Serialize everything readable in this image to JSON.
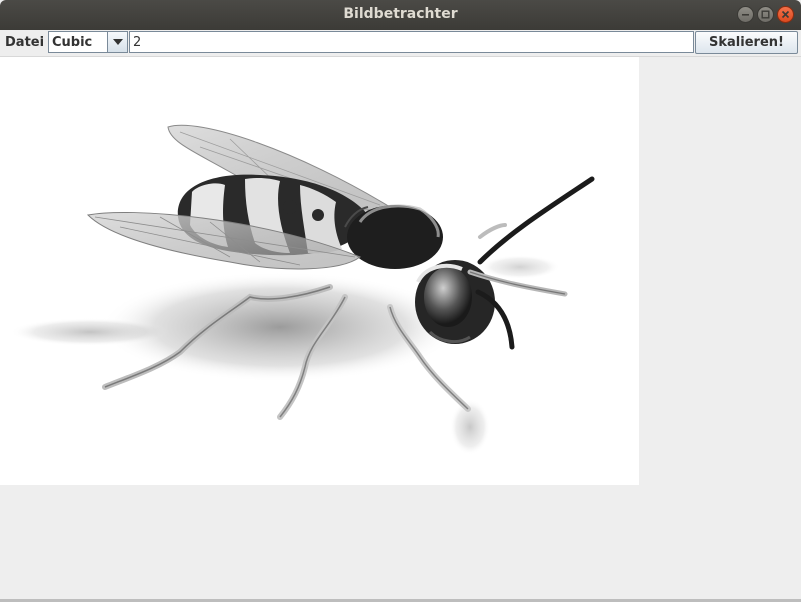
{
  "window": {
    "title": "Bildbetrachter",
    "controls": [
      "minimize-icon",
      "maximize-icon",
      "close-icon"
    ]
  },
  "menubar": {
    "datei_label": "Datei"
  },
  "toolbar": {
    "interpolation_selected": "Cubic",
    "scale_value": "2",
    "scale_button_label": "Skalieren!"
  },
  "image": {
    "subject": "wasp-photo-grayscale"
  },
  "colors": {
    "titlebar": "#3c3b37",
    "title_text": "#dfdbd2",
    "close_button": "#e95420",
    "background": "#eeeeee",
    "image_bg": "#ffffff"
  }
}
